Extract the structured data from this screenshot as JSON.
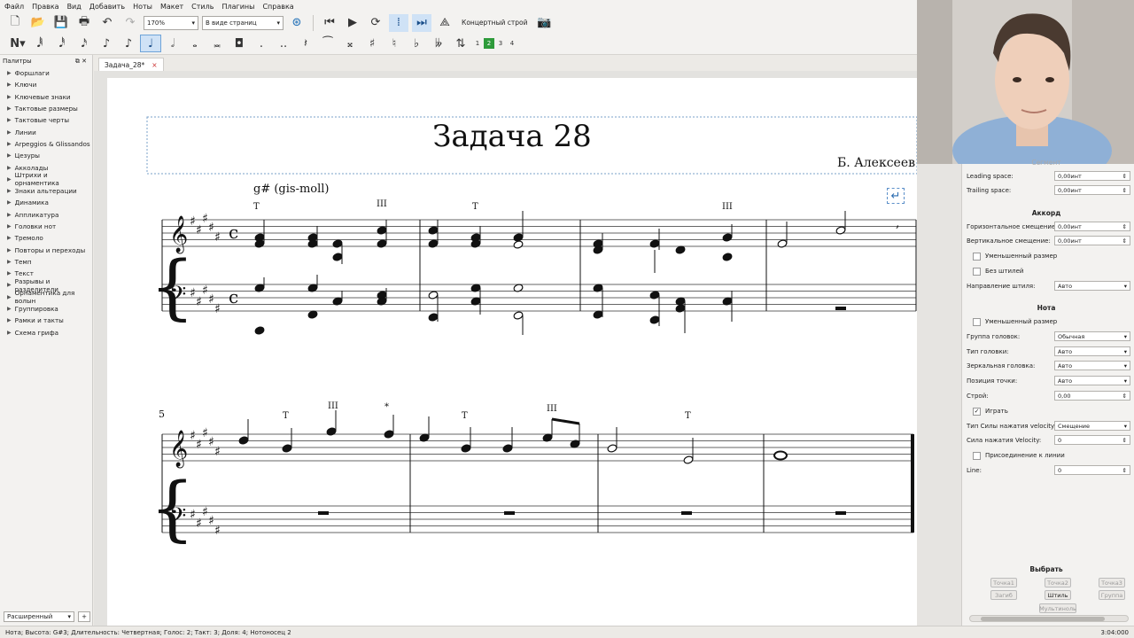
{
  "menu": [
    "Файл",
    "Правка",
    "Вид",
    "Добавить",
    "Ноты",
    "Макет",
    "Стиль",
    "Плагины",
    "Справка"
  ],
  "toolbar": {
    "zoom": "170%",
    "view_mode": "В виде страниц",
    "concert_pitch": "Концертный строй"
  },
  "note_toolbar": {
    "voices": [
      "1",
      "2",
      "3",
      "4"
    ],
    "active_voice": "2"
  },
  "palettes": {
    "title": "Палитры",
    "items": [
      "Форшлаги",
      "Ключи",
      "Ключевые знаки",
      "Тактовые размеры",
      "Тактовые черты",
      "Линии",
      "Arpeggios & Glissandos",
      "Цезуры",
      "Акколады",
      "Штрихи и орнаментика",
      "Знаки альтерации",
      "Динамика",
      "Аппликатура",
      "Головки нот",
      "Тремоло",
      "Повторы и переходы",
      "Темп",
      "Текст",
      "Разрывы и разделители",
      "Орнаментика для волын",
      "Группировка",
      "Рамки и такты",
      "Схема грифа"
    ],
    "workspace": "Расширенный",
    "add": "+"
  },
  "tab": {
    "label": "Задача_28*",
    "close": "×"
  },
  "score": {
    "title": "Задача 28",
    "composer": "Б. Алексеев",
    "key_text": "g# (gis-moll)",
    "time_sig": "c",
    "measure_number": "5",
    "marks_row1": [
      "T",
      "III",
      "T",
      "III"
    ],
    "marks_row2": [
      "T",
      "III",
      "*",
      "T",
      "III",
      "T"
    ]
  },
  "inspector": {
    "segment": "Сегмент",
    "leading_label": "Leading space:",
    "leading_value": "0,00инт",
    "trailing_label": "Trailing space:",
    "trailing_value": "0,00инт",
    "chord_title": "Аккорд",
    "h_offset_label": "Горизонтальное смещение:",
    "h_offset_value": "0,00инт",
    "v_offset_label": "Вертикальное смещение:",
    "v_offset_value": "0,00инт",
    "small_chord": "Уменьшенный размер",
    "no_stem": "Без штилей",
    "stem_dir_label": "Направление штиля:",
    "stem_dir_value": "Авто",
    "note_title": "Нота",
    "small_note": "Уменьшенный размер",
    "head_group_label": "Группа головок:",
    "head_group_value": "Обычная",
    "head_type_label": "Тип головки:",
    "head_type_value": "Авто",
    "mirror_label": "Зеркальная головка:",
    "mirror_value": "Авто",
    "dot_pos_label": "Позиция точки:",
    "dot_pos_value": "Авто",
    "tuning_label": "Строй:",
    "tuning_value": "0,00",
    "play_label": "Играть",
    "velocity_type_label": "Тип Силы нажатия velocity:",
    "velocity_type_value": "Смещение",
    "velocity_label": "Сила нажатия Velocity:",
    "velocity_value": "0",
    "fix_line_label": "Присоединение к линии",
    "line_label": "Line:",
    "line_value": "0",
    "select_title": "Выбрать",
    "sel_btns": [
      "Точка1",
      "Точка2",
      "Точка3",
      "Загиб",
      "Штиль",
      "Группа",
      "Мультиноль"
    ]
  },
  "status": {
    "text": "Нота; Высота: G#3; Длительность: Четвертная; Голос: 2;  Такт: 3; Доля: 4; Нотоносец 2",
    "time": "3:04:000"
  }
}
